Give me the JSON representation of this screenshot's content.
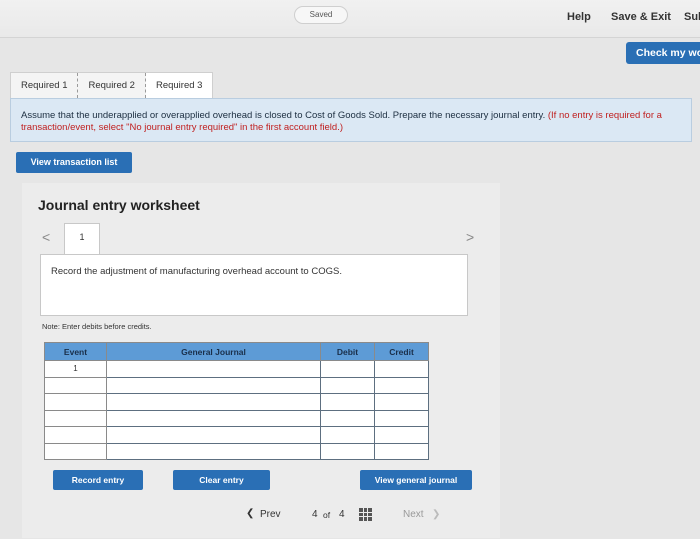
{
  "topbar": {
    "saved_label": "Saved",
    "help_label": "Help",
    "save_exit_label": "Save & Exit",
    "submit_label": "Sul"
  },
  "check_button_label": "Check my wo",
  "tabs": [
    {
      "label": "Required 1"
    },
    {
      "label": "Required 2"
    },
    {
      "label": "Required 3"
    }
  ],
  "instructions": {
    "text": "Assume that the underapplied or overapplied overhead is closed to Cost of Goods Sold. Prepare the necessary journal entry.",
    "hint": "(If no entry is required for a transaction/event, select \"No journal entry required\" in the first account field.)"
  },
  "view_transaction_label": "View transaction list",
  "worksheet": {
    "title": "Journal entry worksheet",
    "prev_arrow": "<",
    "next_arrow": ">",
    "current_page": "1",
    "record_text": "Record the adjustment of manufacturing overhead account to COGS.",
    "note": "Note: Enter debits before credits."
  },
  "journal_table": {
    "headers": {
      "event": "Event",
      "account": "General Journal",
      "debit": "Debit",
      "credit": "Credit"
    },
    "rows": [
      {
        "event": "1",
        "account": "",
        "debit": "",
        "credit": ""
      },
      {
        "event": "",
        "account": "",
        "debit": "",
        "credit": ""
      },
      {
        "event": "",
        "account": "",
        "debit": "",
        "credit": ""
      },
      {
        "event": "",
        "account": "",
        "debit": "",
        "credit": ""
      },
      {
        "event": "",
        "account": "",
        "debit": "",
        "credit": ""
      },
      {
        "event": "",
        "account": "",
        "debit": "",
        "credit": ""
      }
    ]
  },
  "buttons": {
    "record_entry": "Record entry",
    "clear_entry": "Clear entry",
    "view_general_journal": "View general journal"
  },
  "pager": {
    "prev_label": "Prev",
    "page_current": "4",
    "page_of": "of",
    "page_total": "4",
    "next_label": "Next"
  },
  "colors": {
    "primary_button": "#2a6fb5",
    "table_header": "#5d9bd6",
    "instruction_bg": "#dbe8f4",
    "hint_red": "#c02020"
  },
  "icons": [
    "chevron-left-icon",
    "chevron-right-icon",
    "grid-icon"
  ]
}
